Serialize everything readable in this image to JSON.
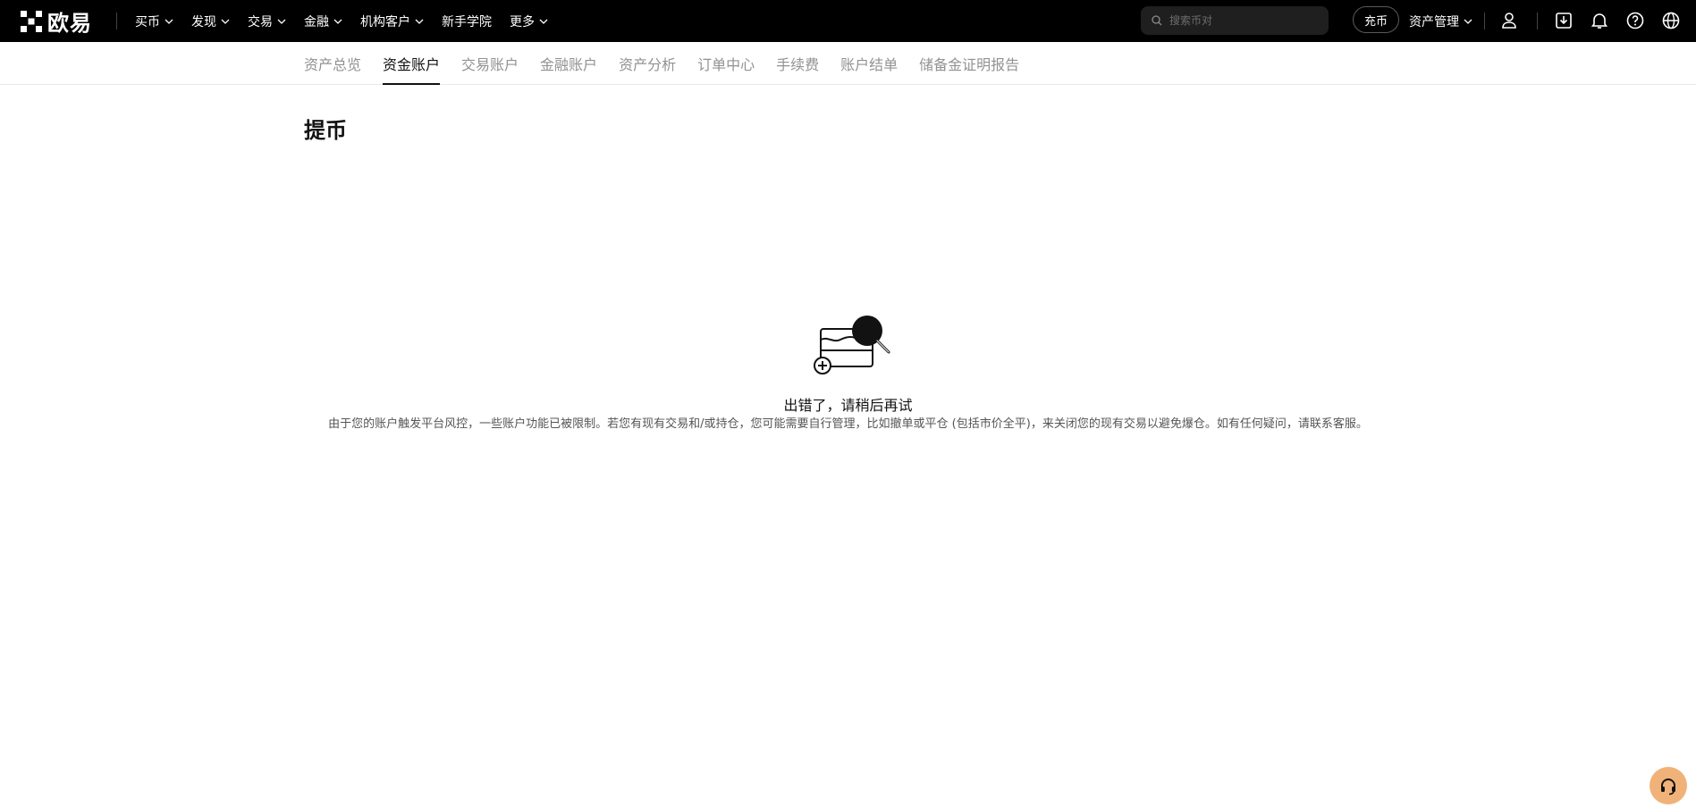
{
  "header": {
    "logo_text": "欧易",
    "nav": [
      {
        "label": "买币",
        "dropdown": true
      },
      {
        "label": "发现",
        "dropdown": true
      },
      {
        "label": "交易",
        "dropdown": true
      },
      {
        "label": "金融",
        "dropdown": true
      },
      {
        "label": "机构客户",
        "dropdown": true
      },
      {
        "label": "新手学院",
        "dropdown": false
      },
      {
        "label": "更多",
        "dropdown": true
      }
    ],
    "search_placeholder": "搜索币对",
    "deposit_label": "充币",
    "asset_management_label": "资产管理",
    "icons": [
      "user-icon",
      "download-icon",
      "bell-icon",
      "help-icon",
      "globe-icon"
    ]
  },
  "subnav": {
    "tabs": [
      {
        "label": "资产总览",
        "active": false
      },
      {
        "label": "资金账户",
        "active": true
      },
      {
        "label": "交易账户",
        "active": false
      },
      {
        "label": "金融账户",
        "active": false
      },
      {
        "label": "资产分析",
        "active": false
      },
      {
        "label": "订单中心",
        "active": false
      },
      {
        "label": "手续费",
        "active": false
      },
      {
        "label": "账户结单",
        "active": false
      },
      {
        "label": "储备金证明报告",
        "active": false
      }
    ]
  },
  "page": {
    "title": "提币"
  },
  "error": {
    "title": "出错了，请稍后再试",
    "description": "由于您的账户触发平台风控，一些账户功能已被限制。若您有现有交易和/或持仓，您可能需要自行管理，比如撤单或平仓 (包括市价全平)，来关闭您的现有交易以避免爆仓。如有任何疑问，请联系客服。"
  },
  "colors": {
    "header_bg": "#000000",
    "support_button": "#f1b27a",
    "active_tab": "#121212",
    "inactive_tab": "#929292"
  }
}
